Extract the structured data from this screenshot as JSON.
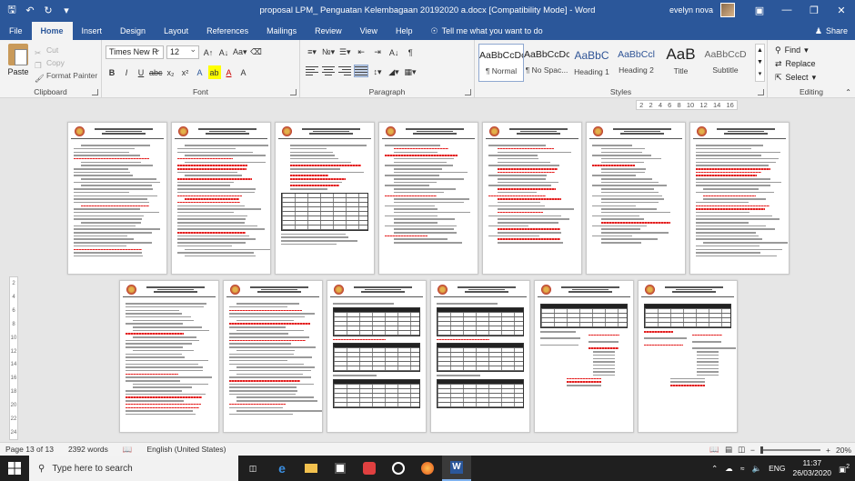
{
  "window": {
    "title": "proposal LPM_ Penguatan Kelembagaan 20192020 a.docx [Compatibility Mode] - Word",
    "user": "evelyn nova"
  },
  "tabs": [
    {
      "label": "File"
    },
    {
      "label": "Home"
    },
    {
      "label": "Insert"
    },
    {
      "label": "Design"
    },
    {
      "label": "Layout"
    },
    {
      "label": "References"
    },
    {
      "label": "Mailings"
    },
    {
      "label": "Review"
    },
    {
      "label": "View"
    },
    {
      "label": "Help"
    }
  ],
  "tell_me": "Tell me what you want to do",
  "share_label": "Share",
  "clipboard": {
    "paste": "Paste",
    "cut": "Cut",
    "copy": "Copy",
    "format_painter": "Format Painter",
    "label": "Clipboard"
  },
  "font": {
    "name": "Times New R",
    "size": "12",
    "label": "Font"
  },
  "paragraph": {
    "label": "Paragraph"
  },
  "styles": {
    "items": [
      {
        "sample": "AaBbCcDc",
        "name": "¶ Normal"
      },
      {
        "sample": "AaBbCcDc",
        "name": "¶ No Spac..."
      },
      {
        "sample": "AaBbC",
        "name": "Heading 1"
      },
      {
        "sample": "AaBbCcl",
        "name": "Heading 2"
      },
      {
        "sample": "AaB",
        "name": "Title"
      },
      {
        "sample": "AaBbCcD",
        "name": "Subtitle"
      }
    ],
    "label": "Styles"
  },
  "editing": {
    "find": "Find",
    "replace": "Replace",
    "select": "Select",
    "label": "Editing"
  },
  "ruler_ticks": [
    "2",
    "2",
    "4",
    "6",
    "8",
    "10",
    "12",
    "14",
    "16"
  ],
  "vruler_ticks": [
    "2",
    "4",
    "6",
    "8",
    "10",
    "12",
    "14",
    "16",
    "18",
    "20",
    "22",
    "24"
  ],
  "status": {
    "page": "Page 13 of 13",
    "words": "2392 words",
    "language": "English (United States)",
    "zoom": "20%"
  },
  "taskbar": {
    "search_placeholder": "Type here to search",
    "lang": "ENG",
    "time": "11:37",
    "date": "26/03/2020",
    "notifications": "2"
  }
}
